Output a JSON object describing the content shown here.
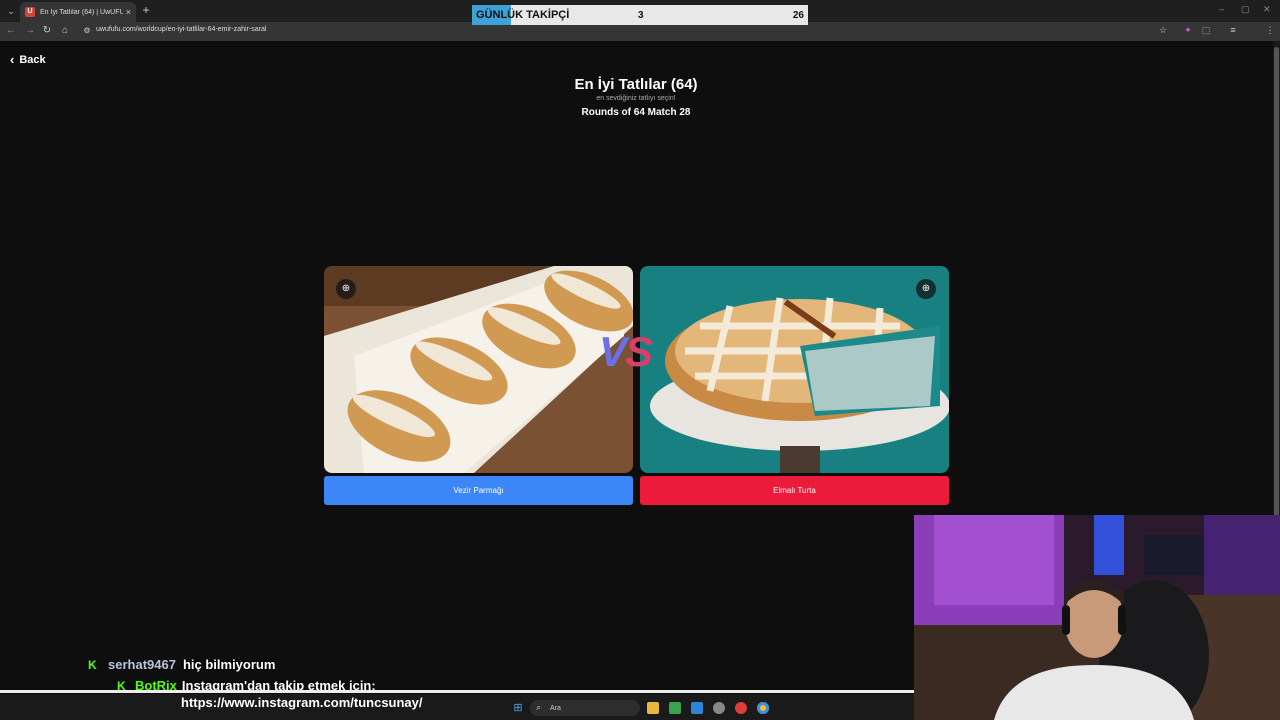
{
  "browser": {
    "tab_title": "En İyi Tatlılar (64) | UwUFUFU",
    "tab_favicon": "U",
    "tab_close": "×",
    "new_tab": "+",
    "tab_list": "⌄",
    "url": "uwufufu.com/worldcup/en-iyi-tatlilar-64-emir-zahir-saral",
    "nav": {
      "back": "←",
      "forward": "→",
      "reload": "↻",
      "home": "⌂",
      "site_info": "⚙"
    },
    "toolbar": {
      "bookmark": "☆",
      "extension": "✦",
      "extensions": "⬚",
      "media": "≡",
      "menu": "⋮"
    },
    "window": {
      "minimize": "–",
      "maximize": "▢",
      "close": "✕"
    }
  },
  "follower_goal": {
    "label": "GÜNLÜK TAKİPÇİ",
    "current": "3",
    "goal": "26",
    "progress": 0.115,
    "fill_color": "#3da2d8"
  },
  "page": {
    "back_icon": "‹",
    "back_label": "Back",
    "title": "En İyi Tatlılar (64)",
    "subtitle": "en sevdiğiniz tatlıyı seçin!",
    "round_info": "Rounds of 64 Match 28"
  },
  "match": {
    "left": {
      "name": "Vezir Parmağı",
      "button_color": "#3d86f7"
    },
    "right": {
      "name": "Elmalı Turta",
      "button_color": "#ec1b3b"
    },
    "vs_v": "V",
    "vs_s": "S",
    "zoom_icon": "⊕"
  },
  "chat": [
    {
      "user": "serhat9467",
      "message": "hiç bilmiyorum"
    },
    {
      "user": "BotRix",
      "message": "Instagram'dan takip etmek için:",
      "continuation": "https://www.instagram.com/tuncsunay/"
    }
  ],
  "chat_icon": "K",
  "taskbar": {
    "start_icon": "⊞",
    "search_icon": "⌕",
    "search_placeholder": "Ara"
  }
}
